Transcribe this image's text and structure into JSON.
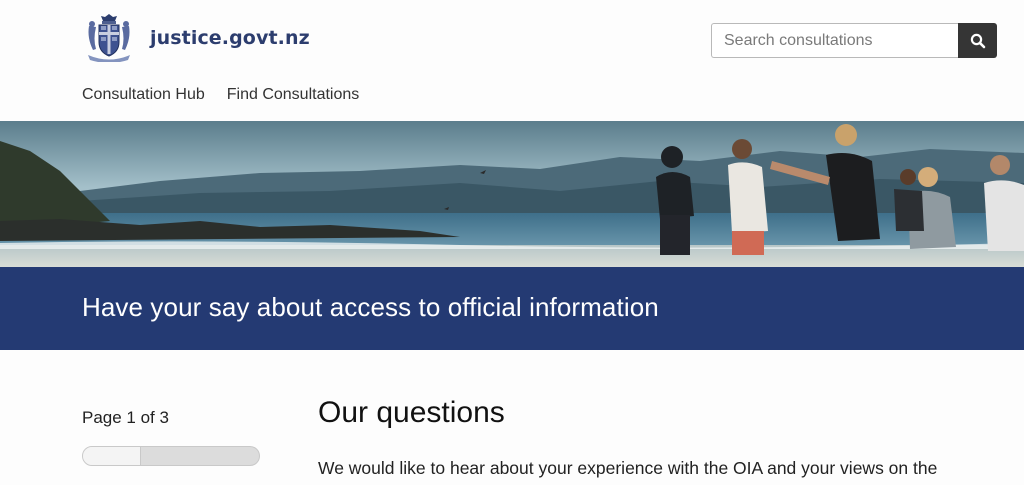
{
  "header": {
    "brand": "justice.govt.nz",
    "logo_icon": "nz-coat-of-arms-icon",
    "search": {
      "placeholder": "Search consultations",
      "button_icon": "search-icon"
    }
  },
  "nav": {
    "items": [
      {
        "label": "Consultation Hub"
      },
      {
        "label": "Find Consultations"
      }
    ]
  },
  "hero": {
    "image": "group-of-people-running-on-beach-photo"
  },
  "banner": {
    "title": "Have your say about access to official information"
  },
  "sidebar": {
    "page_label": "Page 1 of 3",
    "progress": 0.33
  },
  "main": {
    "heading": "Our questions",
    "intro": "We would like to hear about your experience with the OIA and your views on the"
  },
  "colors": {
    "banner": "#243a73",
    "brand": "#2c3d6e",
    "search_button": "#353535"
  }
}
